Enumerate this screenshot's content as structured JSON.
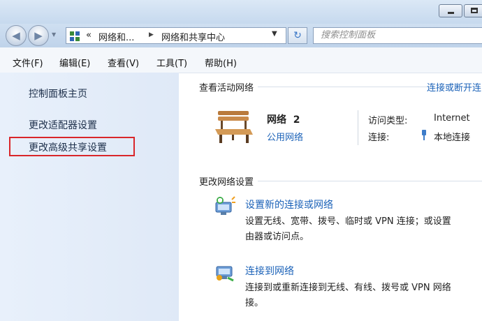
{
  "titlebar": {
    "minimize_icon": "minimize-icon",
    "maximize_icon": "maximize-icon"
  },
  "address_bar": {
    "chevron": "«",
    "crumb1": "网络和...",
    "arrow": "▶",
    "crumb2": "网络和共享中心",
    "dropdown": "▼",
    "refresh": "↻",
    "search_placeholder": "搜索控制面板"
  },
  "menu": [
    "文件(F)",
    "编辑(E)",
    "查看(V)",
    "工具(T)",
    "帮助(H)"
  ],
  "sidebar": {
    "items": [
      "控制面板主页",
      "更改适配器设置",
      "更改高级共享设置"
    ],
    "highlight_color": "#d9262a"
  },
  "active_networks": {
    "title": "查看活动网络",
    "link": "连接或断开连",
    "network_name": "网络  2",
    "network_type": "公用网络",
    "access_type_label": "访问类型:",
    "access_type_value": "Internet",
    "connections_label": "连接:",
    "connections_value": "本地连接"
  },
  "change_settings": {
    "title": "更改网络设置",
    "tasks": [
      {
        "link": "设置新的连接或网络",
        "desc1": "设置无线、宽带、拨号、临时或 VPN 连接；或设置",
        "desc2": "由器或访问点。",
        "icon": "new-connection-icon"
      },
      {
        "link": "连接到网络",
        "desc1": "连接到或重新连接到无线、有线、拨号或 VPN 网络",
        "desc2": "接。",
        "icon": "connect-network-icon"
      }
    ]
  },
  "colors": {
    "link": "#1b62b8",
    "sidebar_bg": "#e4edf9"
  }
}
